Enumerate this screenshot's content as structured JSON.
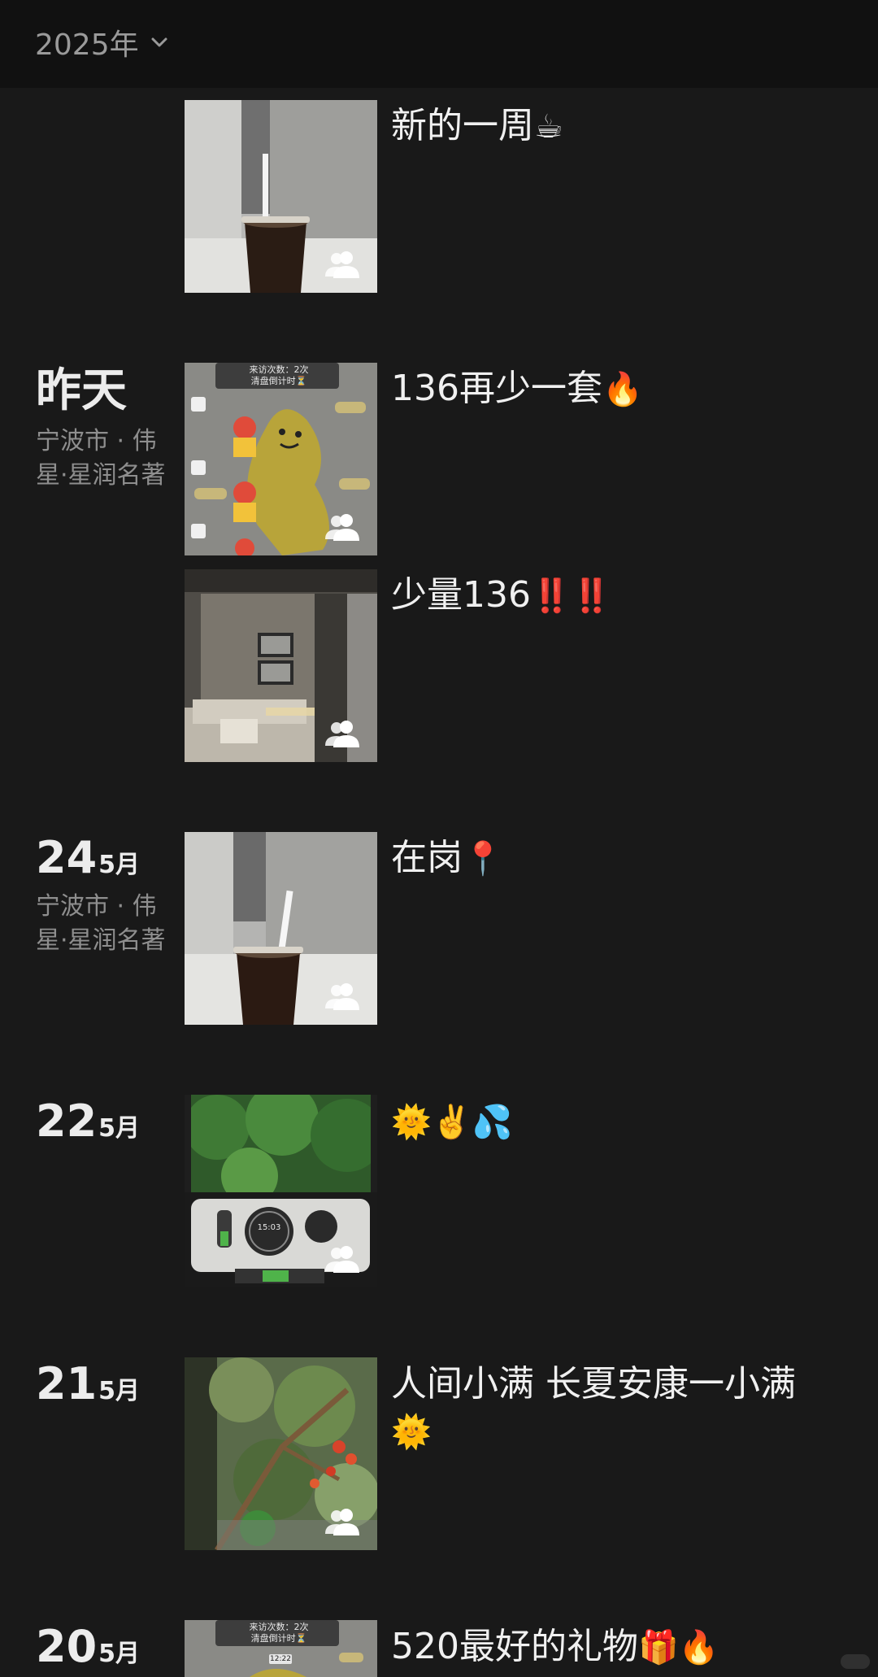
{
  "header": {
    "year": "2025年"
  },
  "entries": [
    {
      "caption": "新的一周",
      "emoji": "☕"
    },
    {
      "day": "昨天",
      "location": "宁波市 · 伟星·星润名著",
      "caption": "136再少一套",
      "emoji": "🔥"
    },
    {
      "caption": "少量136",
      "emoji": "‼️‼️"
    },
    {
      "day": "24",
      "month": "5月",
      "location": "宁波市 · 伟星·星润名著",
      "caption": "在岗",
      "emoji": "📍"
    },
    {
      "day": "22",
      "month": "5月",
      "caption": "",
      "emoji": "🌞✌️💦"
    },
    {
      "day": "21",
      "month": "5月",
      "caption": "人间小满 长夏安康一小满",
      "emoji": "🌞"
    },
    {
      "day": "20",
      "month": "5月",
      "caption": "520最好的礼物",
      "emoji": "🎁🔥"
    }
  ],
  "screenshot_overlay": {
    "line1": "来访次数：2次",
    "line2": "清盘倒计时⏳",
    "time": "12:22"
  },
  "treadmill_time": "15:03",
  "icons": {
    "friends_visible": "two-person-icon",
    "dropdown": "chevron-down-icon"
  }
}
